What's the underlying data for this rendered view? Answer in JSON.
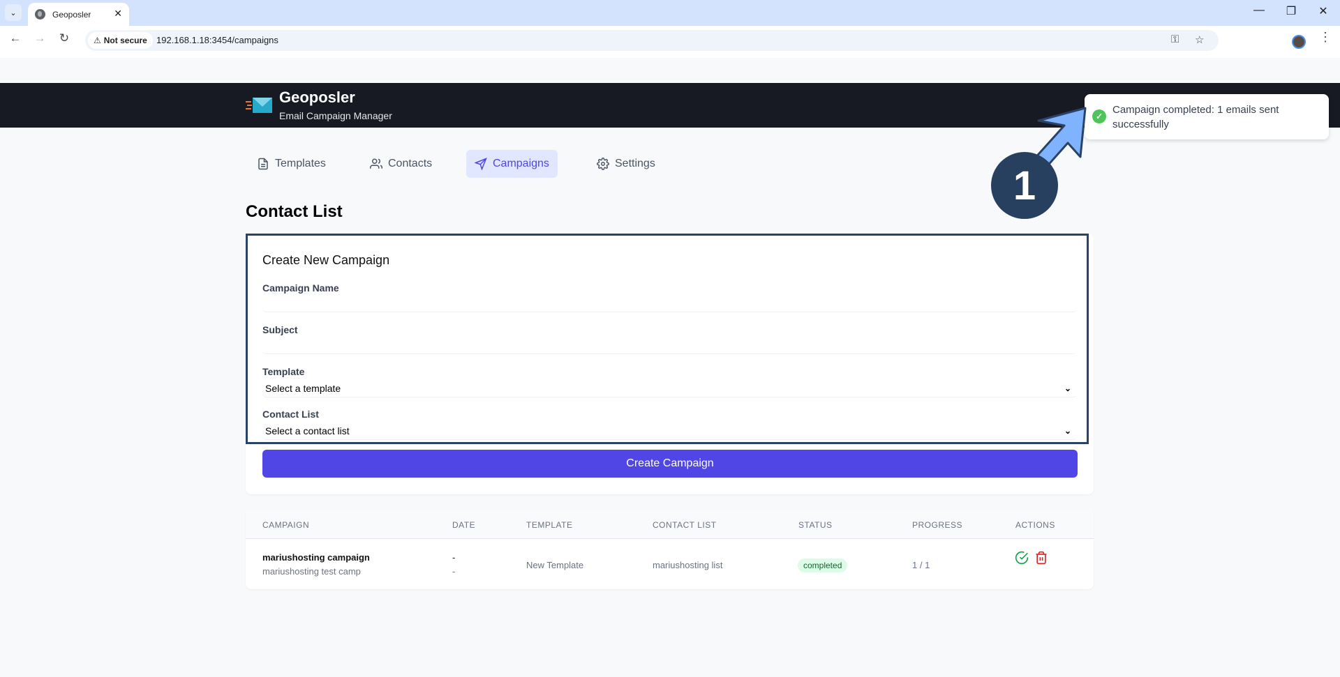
{
  "browser": {
    "tab_title": "Geoposler",
    "security_label": "Not secure",
    "url": "192.168.1.18:3454/campaigns"
  },
  "app": {
    "title": "Geoposler",
    "subtitle": "Email Campaign Manager"
  },
  "nav": {
    "items": [
      {
        "label": "Templates",
        "icon": "document-icon",
        "active": false
      },
      {
        "label": "Contacts",
        "icon": "users-icon",
        "active": false
      },
      {
        "label": "Campaigns",
        "icon": "send-icon",
        "active": true
      },
      {
        "label": "Settings",
        "icon": "gear-icon",
        "active": false
      }
    ]
  },
  "page": {
    "title": "Contact List"
  },
  "form": {
    "title": "Create New Campaign",
    "campaign_name_label": "Campaign Name",
    "campaign_name_value": "",
    "subject_label": "Subject",
    "subject_value": "",
    "template_label": "Template",
    "template_selected": "Select a template",
    "contact_list_label": "Contact List",
    "contact_list_selected": "Select a contact list",
    "submit_label": "Create Campaign"
  },
  "table": {
    "headers": [
      "CAMPAIGN",
      "DATE",
      "TEMPLATE",
      "CONTACT LIST",
      "STATUS",
      "PROGRESS",
      "ACTIONS"
    ],
    "rows": [
      {
        "name": "mariushosting campaign",
        "description": "mariushosting test camp",
        "date_line1": "-",
        "date_line2": "-",
        "template": "New Template",
        "contact_list": "mariushosting list",
        "status": "completed",
        "progress": "1 / 1",
        "actions": [
          "check-circle-icon",
          "trash-icon"
        ]
      }
    ]
  },
  "toast": {
    "message": "Campaign completed: 1 emails sent successfully",
    "type": "success"
  },
  "annotation": {
    "step_number": "1"
  },
  "colors": {
    "accent": "#4f46e5",
    "header_bg": "#171923",
    "success": "#22c55e",
    "danger": "#dc2626",
    "annotation": "#2a4365",
    "arrow": "#7fb2ff"
  }
}
